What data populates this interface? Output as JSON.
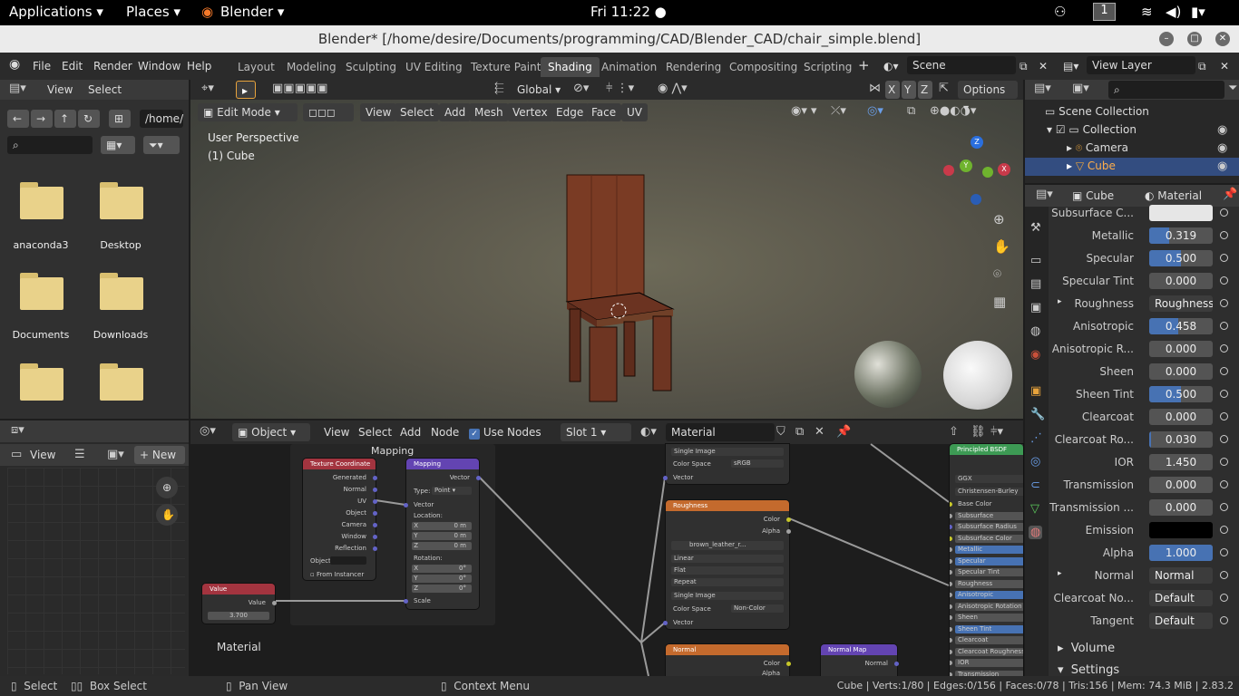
{
  "system": {
    "applications": "Applications",
    "places": "Places",
    "app": "Blender",
    "clock": "Fri 11:22",
    "workspace_num": "1"
  },
  "window": {
    "title": "Blender* [/home/desire/Documents/programming/CAD/Blender_CAD/chair_simple.blend]"
  },
  "menu": [
    "File",
    "Edit",
    "Render",
    "Window",
    "Help"
  ],
  "workspaces": [
    "Layout",
    "Modeling",
    "Sculpting",
    "UV Editing",
    "Texture Paint",
    "Shading",
    "Animation",
    "Rendering",
    "Compositing",
    "Scripting"
  ],
  "scene": {
    "name": "Scene",
    "view_layer": "View Layer"
  },
  "filebrowser": {
    "view": "View",
    "select": "Select",
    "path": "/home/",
    "folders": [
      "anaconda3",
      "Desktop",
      "Documents",
      "Downloads",
      "",
      ""
    ]
  },
  "viewport": {
    "mode": "Edit Mode",
    "orientation": "Global",
    "options": "Options",
    "menus": [
      "View",
      "Select",
      "Add",
      "Mesh",
      "Vertex",
      "Edge",
      "Face",
      "UV"
    ],
    "info1": "User Perspective",
    "info2": "(1) Cube",
    "axes": {
      "x": "X",
      "y": "Y",
      "z": "Z"
    }
  },
  "outliner": {
    "items": [
      "Scene Collection",
      "Collection",
      "Camera",
      "Cube"
    ]
  },
  "properties": {
    "object": "Cube",
    "material": "Material",
    "rows": [
      {
        "label": "Subsurface C...",
        "value": "",
        "type": "color",
        "color": "#e6e6e6"
      },
      {
        "label": "Metallic",
        "value": "0.319",
        "fill": 0.319
      },
      {
        "label": "Specular",
        "value": "0.500",
        "fill": 0.5
      },
      {
        "label": "Specular Tint",
        "value": "0.000",
        "fill": 0
      },
      {
        "label": "Roughness",
        "value": "Roughness",
        "type": "link"
      },
      {
        "label": "Anisotropic",
        "value": "0.458",
        "fill": 0.458
      },
      {
        "label": "Anisotropic R...",
        "value": "0.000",
        "fill": 0
      },
      {
        "label": "Sheen",
        "value": "0.000",
        "fill": 0
      },
      {
        "label": "Sheen Tint",
        "value": "0.500",
        "fill": 0.5
      },
      {
        "label": "Clearcoat",
        "value": "0.000",
        "fill": 0
      },
      {
        "label": "Clearcoat Ro...",
        "value": "0.030",
        "fill": 0.03
      },
      {
        "label": "IOR",
        "value": "1.450",
        "fill": 0
      },
      {
        "label": "Transmission",
        "value": "0.000",
        "fill": 0
      },
      {
        "label": "Transmission ...",
        "value": "0.000",
        "fill": 0
      },
      {
        "label": "Emission",
        "value": "",
        "type": "color",
        "color": "#000000"
      },
      {
        "label": "Alpha",
        "value": "1.000",
        "fill": 1
      },
      {
        "label": "Normal",
        "value": "Normal Map",
        "type": "link"
      },
      {
        "label": "Clearcoat No...",
        "value": "Default",
        "type": "link"
      },
      {
        "label": "Tangent",
        "value": "Default",
        "type": "link"
      }
    ],
    "sections": [
      "Volume",
      "Settings"
    ]
  },
  "image_editor": {
    "view": "View",
    "new": "New"
  },
  "node_editor": {
    "object": "Object",
    "menus": [
      "View",
      "Select",
      "Add",
      "Node"
    ],
    "use_nodes": "Use Nodes",
    "slot": "Slot 1",
    "material": "Material",
    "frame_label": "Mapping",
    "mat_label": "Material",
    "tex_coord": {
      "title": "Texture Coordinate",
      "outs": [
        "Generated",
        "Normal",
        "UV",
        "Object",
        "Camera",
        "Window",
        "Reflection"
      ],
      "object": "Object",
      "from_instancer": "From Instancer"
    },
    "mapping": {
      "title": "Mapping",
      "vector": "Vector",
      "type_label": "Type:",
      "type": "Point",
      "vec_in": "Vector",
      "location": "Location:",
      "rotation": "Rotation:",
      "scale": "Scale",
      "loc": [
        "0 m",
        "0 m",
        "0 m"
      ],
      "rot": [
        "0°",
        "0°",
        "0°"
      ]
    },
    "value": {
      "title": "Value",
      "out": "Value",
      "val": "3.700"
    },
    "img1": {
      "single": "Single Image",
      "cs_label": "Color Space",
      "cs": "sRGB",
      "vector": "Vector"
    },
    "rough": {
      "title": "Roughness",
      "color": "Color",
      "alpha": "Alpha",
      "image": "brown_leather_r...",
      "interp": "Linear",
      "proj": "Flat",
      "ext": "Repeat",
      "single": "Single Image",
      "cs_label": "Color Space",
      "cs": "Non-Color",
      "vector": "Vector"
    },
    "normal": {
      "title": "Normal",
      "color": "Color",
      "alpha": "Alpha"
    },
    "normal_map": {
      "title": "Normal Map",
      "out": "Normal"
    },
    "bsdf": {
      "title": "Principled BSDF",
      "dist": "GGX",
      "ss": "Christensen-Burley",
      "ins": [
        "Base Color",
        "Subsurface",
        "Subsurface Radius",
        "Subsurface Color",
        "Metallic",
        "Specular",
        "Specular Tint",
        "Roughness",
        "Anisotropic",
        "Anisotropic Rotation",
        "Sheen",
        "Sheen Tint",
        "Clearcoat",
        "Clearcoat Roughness",
        "IOR",
        "Transmission"
      ]
    }
  },
  "status": {
    "select": "Select",
    "box": "Box Select",
    "pan": "Pan View",
    "context": "Context Menu",
    "stats": "Cube | Verts:1/80 | Edges:0/156 | Faces:0/78 | Tris:156 | Mem: 74.3 MiB | 2.83.2"
  }
}
